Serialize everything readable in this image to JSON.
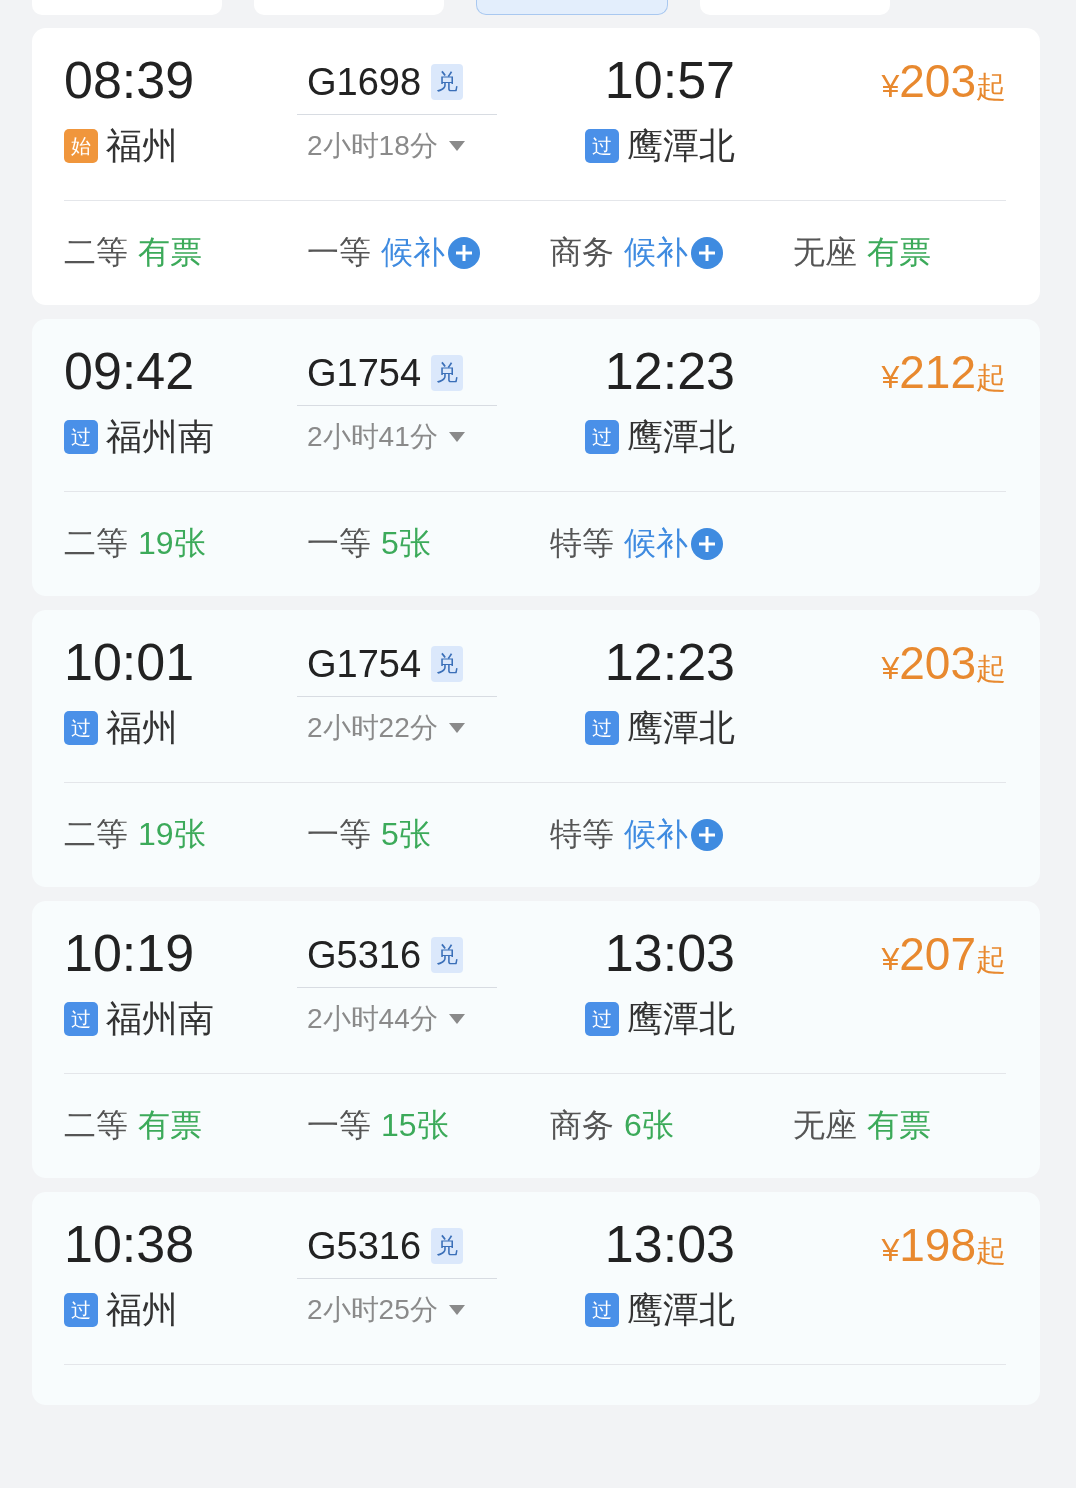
{
  "tabs": [
    {
      "selected": false
    },
    {
      "selected": false
    },
    {
      "selected": true
    },
    {
      "selected": false
    }
  ],
  "trains": [
    {
      "depart_time": "08:39",
      "depart_station": {
        "badge": "始",
        "kind": "start",
        "name": "福州"
      },
      "train_no": "G1698",
      "redeem_badge": "兑",
      "duration": "2小时18分",
      "arrive_time": "10:57",
      "arrive_station": {
        "badge": "过",
        "kind": "pass",
        "name": "鹰潭北"
      },
      "price": {
        "symbol": "¥",
        "amount": "203",
        "suffix": "起"
      },
      "seats": [
        {
          "class": "二等",
          "status": "有票",
          "kind": "available"
        },
        {
          "class": "一等",
          "status": "候补",
          "kind": "waitlist"
        },
        {
          "class": "商务",
          "status": "候补",
          "kind": "waitlist"
        },
        {
          "class": "无座",
          "status": "有票",
          "kind": "available"
        }
      ]
    },
    {
      "depart_time": "09:42",
      "depart_station": {
        "badge": "过",
        "kind": "pass",
        "name": "福州南"
      },
      "train_no": "G1754",
      "redeem_badge": "兑",
      "duration": "2小时41分",
      "arrive_time": "12:23",
      "arrive_station": {
        "badge": "过",
        "kind": "pass",
        "name": "鹰潭北"
      },
      "price": {
        "symbol": "¥",
        "amount": "212",
        "suffix": "起"
      },
      "seats": [
        {
          "class": "二等",
          "status": "19张",
          "kind": "available"
        },
        {
          "class": "一等",
          "status": "5张",
          "kind": "available"
        },
        {
          "class": "特等",
          "status": "候补",
          "kind": "waitlist"
        }
      ]
    },
    {
      "depart_time": "10:01",
      "depart_station": {
        "badge": "过",
        "kind": "pass",
        "name": "福州"
      },
      "train_no": "G1754",
      "redeem_badge": "兑",
      "duration": "2小时22分",
      "arrive_time": "12:23",
      "arrive_station": {
        "badge": "过",
        "kind": "pass",
        "name": "鹰潭北"
      },
      "price": {
        "symbol": "¥",
        "amount": "203",
        "suffix": "起"
      },
      "seats": [
        {
          "class": "二等",
          "status": "19张",
          "kind": "available"
        },
        {
          "class": "一等",
          "status": "5张",
          "kind": "available"
        },
        {
          "class": "特等",
          "status": "候补",
          "kind": "waitlist"
        }
      ]
    },
    {
      "depart_time": "10:19",
      "depart_station": {
        "badge": "过",
        "kind": "pass",
        "name": "福州南"
      },
      "train_no": "G5316",
      "redeem_badge": "兑",
      "duration": "2小时44分",
      "arrive_time": "13:03",
      "arrive_station": {
        "badge": "过",
        "kind": "pass",
        "name": "鹰潭北"
      },
      "price": {
        "symbol": "¥",
        "amount": "207",
        "suffix": "起"
      },
      "seats": [
        {
          "class": "二等",
          "status": "有票",
          "kind": "available"
        },
        {
          "class": "一等",
          "status": "15张",
          "kind": "available"
        },
        {
          "class": "商务",
          "status": "6张",
          "kind": "available"
        },
        {
          "class": "无座",
          "status": "有票",
          "kind": "available"
        }
      ]
    },
    {
      "depart_time": "10:38",
      "depart_station": {
        "badge": "过",
        "kind": "pass",
        "name": "福州"
      },
      "train_no": "G5316",
      "redeem_badge": "兑",
      "duration": "2小时25分",
      "arrive_time": "13:03",
      "arrive_station": {
        "badge": "过",
        "kind": "pass",
        "name": "鹰潭北"
      },
      "price": {
        "symbol": "¥",
        "amount": "198",
        "suffix": "起"
      }
    }
  ]
}
